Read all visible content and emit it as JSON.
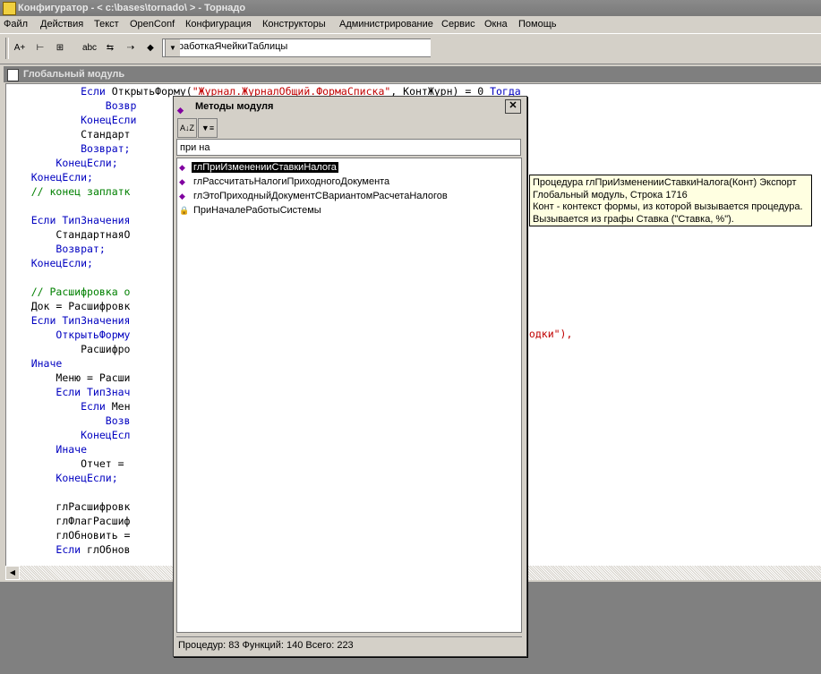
{
  "window": {
    "title": "Конфигуратор - < c:\\bases\\tornado\\ > - Торнадо"
  },
  "menu": [
    "Файл",
    "Действия",
    "Текст",
    "OpenConf",
    "Конфигурация",
    "Конструкторы",
    "Администрирование",
    "Сервис",
    "Окна",
    "Помощь"
  ],
  "toolbar": {
    "combo_value": "ОбработкаЯчейкиТаблицы",
    "combo_arrow": "▼"
  },
  "module_window": {
    "title": "Глобальный модуль"
  },
  "code": {
    "lines": [
      [
        [
          "sp",
          "            "
        ],
        [
          "kw",
          "Если "
        ],
        [
          "tx",
          "ОткрытьФорму("
        ],
        [
          "str",
          "\"Журнал.ЖурналОбщий.ФормаСписка\""
        ],
        [
          "tx",
          ", КонтЖурн) = 0 "
        ],
        [
          "kw",
          "Тогда"
        ]
      ],
      [
        [
          "sp",
          "                "
        ],
        [
          "kw",
          "Возвр"
        ]
      ],
      [
        [
          "sp",
          "            "
        ],
        [
          "kw",
          "КонецЕсли"
        ]
      ],
      [
        [
          "sp",
          "            "
        ],
        [
          "tx",
          "Стандарт"
        ]
      ],
      [
        [
          "sp",
          "            "
        ],
        [
          "kw",
          "Возврат;"
        ]
      ],
      [
        [
          "sp",
          "        "
        ],
        [
          "kw",
          "КонецЕсли;"
        ]
      ],
      [
        [
          "sp",
          "    "
        ],
        [
          "kw",
          "КонецЕсли;"
        ]
      ],
      [
        [
          "sp",
          "    "
        ],
        [
          "cm",
          "// конец заплатк"
        ]
      ],
      [
        [
          "sp",
          ""
        ]
      ],
      [
        [
          "sp",
          "    "
        ],
        [
          "kw",
          "Если ТипЗначения"
        ]
      ],
      [
        [
          "sp",
          "        "
        ],
        [
          "tx",
          "СтандартнаяО"
        ]
      ],
      [
        [
          "sp",
          "        "
        ],
        [
          "kw",
          "Возврат;"
        ]
      ],
      [
        [
          "sp",
          "    "
        ],
        [
          "kw",
          "КонецЕсли;"
        ]
      ],
      [
        [
          "sp",
          ""
        ]
      ],
      [
        [
          "sp",
          "    "
        ],
        [
          "cm",
          "// Расшифровка о"
        ]
      ],
      [
        [
          "sp",
          "    "
        ],
        [
          "tx",
          "Док = Расшифровк"
        ]
      ],
      [
        [
          "sp",
          "    "
        ],
        [
          "kw",
          "Если ТипЗначения"
        ]
      ],
      [
        [
          "sp",
          "        "
        ],
        [
          "kw",
          "ОткрытьФорму"
        ]
      ],
      [
        [
          "sp",
          "            "
        ],
        [
          "tx",
          "Расшифро"
        ]
      ],
      [
        [
          "sp",
          "    "
        ],
        [
          "kw",
          "Иначе"
        ]
      ],
      [
        [
          "sp",
          "        "
        ],
        [
          "tx",
          "Меню = Расши"
        ]
      ],
      [
        [
          "sp",
          "        "
        ],
        [
          "kw",
          "Если ТипЗнач"
        ]
      ],
      [
        [
          "sp",
          "            "
        ],
        [
          "kw",
          "Если "
        ],
        [
          "tx",
          "Мен"
        ]
      ],
      [
        [
          "sp",
          "                "
        ],
        [
          "kw",
          "Возв"
        ]
      ],
      [
        [
          "sp",
          "            "
        ],
        [
          "kw",
          "КонецЕсл"
        ]
      ],
      [
        [
          "sp",
          "        "
        ],
        [
          "kw",
          "Иначе"
        ]
      ],
      [
        [
          "sp",
          "            "
        ],
        [
          "tx",
          "Отчет ="
        ]
      ],
      [
        [
          "sp",
          "        "
        ],
        [
          "kw",
          "КонецЕсли;"
        ]
      ],
      [
        [
          "sp",
          ""
        ]
      ],
      [
        [
          "sp",
          "        "
        ],
        [
          "tx",
          "глРасшифровк"
        ]
      ],
      [
        [
          "sp",
          "        "
        ],
        [
          "tx",
          "глФлагРасшиф"
        ]
      ],
      [
        [
          "sp",
          "        "
        ],
        [
          "tx",
          "глОбновить ="
        ]
      ],
      [
        [
          "sp",
          "        "
        ],
        [
          "kw",
          "Если "
        ],
        [
          "tx",
          "глОбнов"
        ]
      ]
    ],
    "fragments": [
      {
        "text": "водки\"),",
        "color": "#c00000",
        "row": 17
      },
      {
        "text": "/",
        "color": "#008000",
        "row": 7
      }
    ]
  },
  "popup": {
    "title": "Методы модуля",
    "close": "✕",
    "sort_btn": "A↓Z",
    "filter_btn": "▼≡",
    "search_value": "при на",
    "items": [
      {
        "label": "глПриИзмененииСтавкиНалога",
        "selected": true,
        "icon": "method-icon"
      },
      {
        "label": "глРассчитатьНалогиПриходногоДокумента",
        "selected": false,
        "icon": "method-icon"
      },
      {
        "label": "глЭтоПриходныйДокументСВариантомРасчетаНалогов",
        "selected": false,
        "icon": "method-icon"
      },
      {
        "label": "ПриНачалеРаботыСистемы",
        "selected": false,
        "icon": "locked-method-icon"
      }
    ],
    "status": "Процедур: 83 Функций: 140 Всего: 223"
  },
  "tooltip": {
    "lines": [
      "Процедура глПриИзмененииСтавкиНалога(Конт) Экспорт",
      "Глобальный модуль, Строка 1716",
      "Конт - контекст формы, из которой вызывается процедура.",
      "Вызывается из графы Ставка (\"Ставка, %\")."
    ]
  },
  "colors": {
    "keyword": "#0000c0",
    "string": "#c00000",
    "comment": "#008000",
    "selection": "#000000"
  }
}
